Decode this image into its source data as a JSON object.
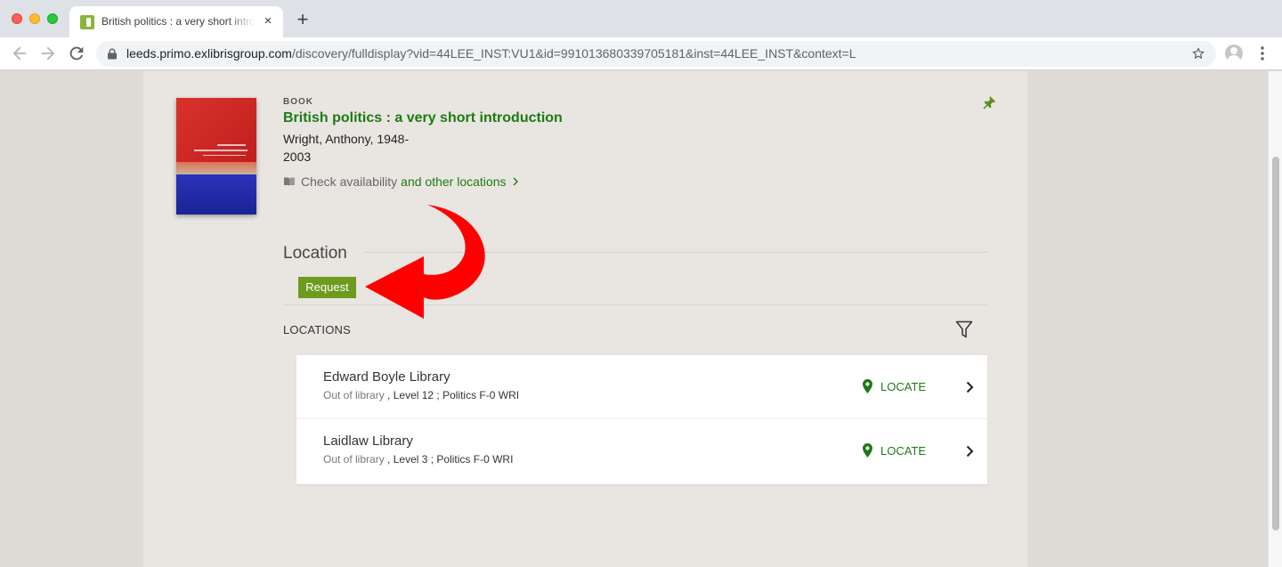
{
  "browser": {
    "tab_title": "British politics : a very short introduction",
    "tab_close": "×",
    "new_tab": "+",
    "url_host": "leeds.primo.exlibrisgroup.com",
    "url_path": "/discovery/fulldisplay?vid=44LEE_INST:VU1&id=991013680339705181&inst=44LEE_INST&context=L"
  },
  "record": {
    "type": "BOOK",
    "title": "British politics : a very short introduction",
    "author": "Wright, Anthony, 1948-",
    "year": "2003",
    "availability_text": "Check availability",
    "availability_link": "and other locations"
  },
  "location_section": {
    "heading": "Location",
    "request_label": "Request",
    "locations_heading": "LOCATIONS",
    "items": [
      {
        "name": "Edward Boyle Library",
        "status": "Out of library",
        "detail": ", Level 12 ; Politics F-0 WRI",
        "locate_label": "LOCATE"
      },
      {
        "name": "Laidlaw Library",
        "status": "Out of library",
        "detail": ", Level 3 ; Politics F-0 WRI",
        "locate_label": "LOCATE"
      }
    ]
  },
  "colors": {
    "brand_green": "#1e7a14",
    "request_green": "#6e9a1e",
    "annotation_red": "#ff0000"
  },
  "icons": [
    "lock-icon",
    "star-icon",
    "profile-icon",
    "menu-icon",
    "book-icon",
    "pin-icon",
    "filter-icon",
    "map-pin-icon",
    "chevron-right-icon",
    "curved-arrow-icon"
  ]
}
